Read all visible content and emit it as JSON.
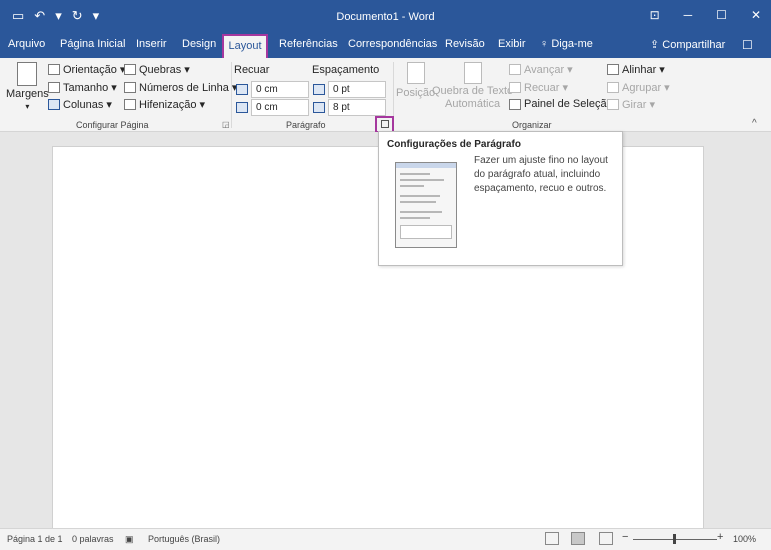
{
  "titlebar": {
    "title": "Documento1 - Word",
    "qat": {
      "save_icon": "save-icon",
      "undo_icon": "undo-icon",
      "undo_more": "▾",
      "redo_icon": "redo-icon",
      "customize": "▾"
    },
    "controls": {
      "ribbon_display": "⊡",
      "minimize": "─",
      "maximize": "☐",
      "close": "✕"
    }
  },
  "tabs": [
    "Arquivo",
    "Página Inicial",
    "Inserir",
    "Design",
    "Layout",
    "Referências",
    "Correspondências",
    "Revisão",
    "Exibir"
  ],
  "tell_me": "Diga-me",
  "share": "Compartilhar",
  "ribbon": {
    "page_setup": {
      "label": "Configurar Página",
      "margins": "Margens",
      "orientation": "Orientação",
      "size": "Tamanho",
      "columns": "Colunas",
      "breaks": "Quebras",
      "line_numbers": "Números de Linha",
      "hyphenation": "Hifenização"
    },
    "paragraph": {
      "label": "Parágrafo",
      "indent_label": "Recuar",
      "spacing_label": "Espaçamento",
      "indent_left": "0 cm",
      "indent_right": "0 cm",
      "spacing_before": "0 pt",
      "spacing_after": "8 pt"
    },
    "arrange": {
      "label": "Organizar",
      "position": "Posição",
      "wrap_text_1": "Quebra de Texto",
      "wrap_text_2": "Automática",
      "bring_forward": "Avançar",
      "send_backward": "Recuar",
      "selection_pane": "Painel de Seleção",
      "align": "Alinhar",
      "group": "Agrupar",
      "rotate": "Girar"
    }
  },
  "tooltip": {
    "title": "Configurações de Parágrafo",
    "body": "Fazer um ajuste fino no layout do parágrafo atual, incluindo espaçamento, recuo e outros."
  },
  "status": {
    "page": "Página 1 de 1",
    "words": "0 palavras",
    "language": "Português (Brasil)",
    "zoom": "100%",
    "zoom_minus": "−",
    "zoom_plus": "+"
  },
  "colors": {
    "accent": "#2b579a",
    "highlight": "#a5379e"
  }
}
